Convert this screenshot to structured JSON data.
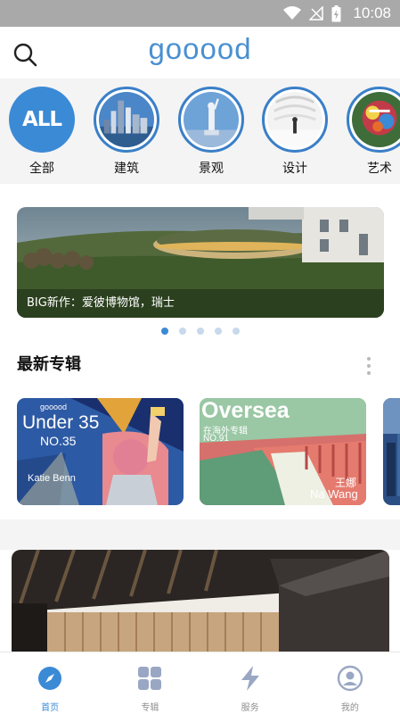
{
  "status_bar": {
    "time": "10:08"
  },
  "header": {
    "logo": "gooood"
  },
  "categories": [
    {
      "label": "全部",
      "badge": "ALL"
    },
    {
      "label": "建筑"
    },
    {
      "label": "景观"
    },
    {
      "label": "设计"
    },
    {
      "label": "艺术"
    }
  ],
  "banner": {
    "caption": "BIG新作：爱彼博物馆，瑞士",
    "page_count": 5,
    "active_page": 1
  },
  "section": {
    "title": "最新专辑"
  },
  "albums": [
    {
      "brand": "gooood",
      "title": "Under 35",
      "number": "NO.35",
      "author": "Katie Benn"
    },
    {
      "title": "Oversea",
      "subtitle": "在海外专辑",
      "number": "NO.91",
      "author_cn": "王娜",
      "author": "Na Wang"
    }
  ],
  "bottom_nav": [
    {
      "label": "首页",
      "icon": "compass-icon",
      "active": true
    },
    {
      "label": "专辑",
      "icon": "grid-icon",
      "active": false
    },
    {
      "label": "服务",
      "icon": "lightning-icon",
      "active": false
    },
    {
      "label": "我的",
      "icon": "profile-icon",
      "active": false
    }
  ],
  "colors": {
    "accent": "#3b8ad6",
    "status_bar": "#a9a9a9",
    "icon_gray": "#9aa7c4"
  }
}
